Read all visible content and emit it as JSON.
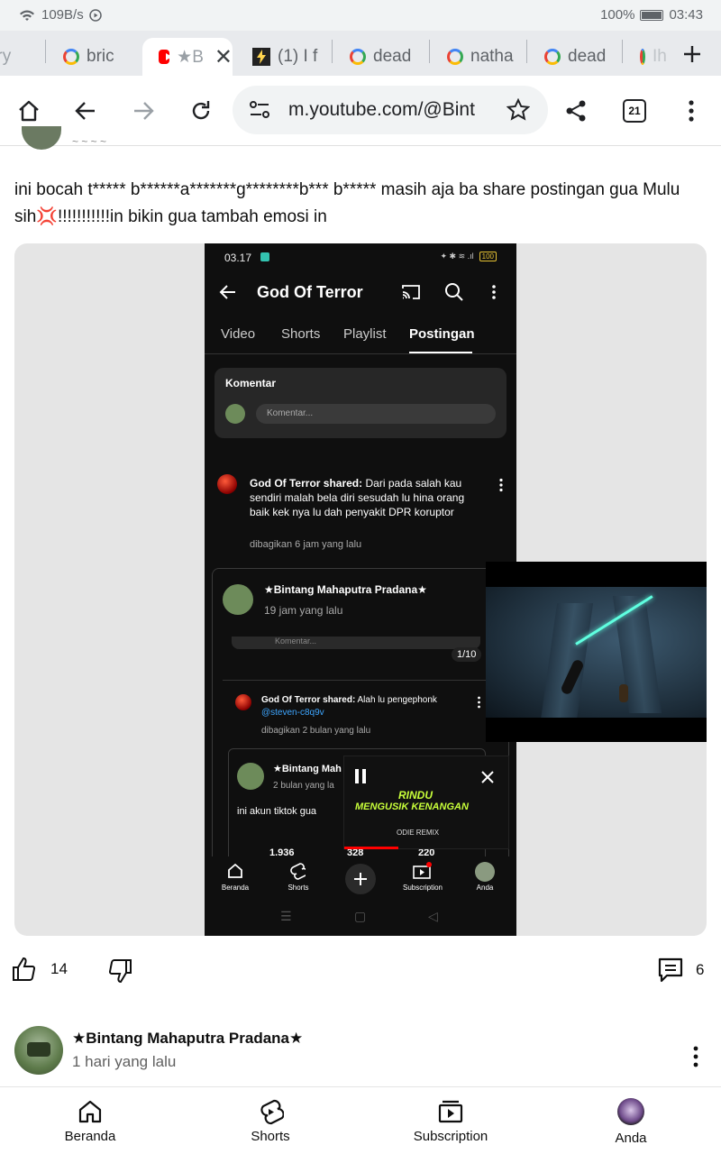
{
  "status_bar": {
    "network_speed": "109B/s",
    "battery": "100%",
    "time": "03:43"
  },
  "tabs": [
    {
      "title": "bric"
    },
    {
      "title": "★B"
    },
    {
      "title": "(1) I f"
    },
    {
      "title": "dead"
    },
    {
      "title": "natha"
    },
    {
      "title": "dead"
    },
    {
      "title": "Ih..."
    }
  ],
  "toolbar": {
    "url": "m.youtube.com/@Bint",
    "tab_count": "21"
  },
  "post": {
    "text": "ini bocah t***** b******a*******g********b*** b***** masih aja ba share postingan gua Mulu sih💢!!!!!!!!!!!in bikin gua tambah emosi in",
    "likes": "14",
    "comments": "6"
  },
  "screenshot": {
    "time": "03.17",
    "battery": "100",
    "channel_title": "God Of Terror",
    "tabs": [
      "Video",
      "Shorts",
      "Playlist",
      "Postingan"
    ],
    "comment_box_title": "Komentar",
    "comment_placeholder": "Komentar...",
    "shared1_author": "God Of Terror shared:",
    "shared1_text": "Dari pada salah kau sendiri malah bela diri sesudah lu hina orang baik kek nya lu dah penyakit DPR koruptor",
    "shared1_time": "dibagikan 6 jam yang lalu",
    "inner_author": "★Bintang Mahaputra Pradana★",
    "inner_time": "19 jam yang lalu",
    "inner_input": "Komentar...",
    "page_counter": "1/10",
    "shared2_author": "God Of Terror shared:",
    "shared2_text": "Alah lu pengephonk",
    "shared2_handle": "@steven-c8q9v",
    "shared2_time": "dibagikan 2 bulan yang lalu",
    "inner2_author": "★Bintang Mah",
    "inner2_time": "2 bulan yang la",
    "inner2_text": "ini akun tiktok gua",
    "counts": [
      "1.936",
      "328",
      "220"
    ],
    "mini_title1": "RINDU",
    "mini_title2": "MENGUSIK KENANGAN",
    "mini_sub": "ODIE REMIX",
    "nav": [
      "Beranda",
      "Shorts",
      "Subscription",
      "Anda"
    ]
  },
  "comment": {
    "author": "★Bintang Mahaputra Pradana★",
    "time": "1 hari yang lalu"
  },
  "bottom_nav": {
    "home": "Beranda",
    "shorts": "Shorts",
    "subscriptions": "Subscription",
    "you": "Anda"
  }
}
